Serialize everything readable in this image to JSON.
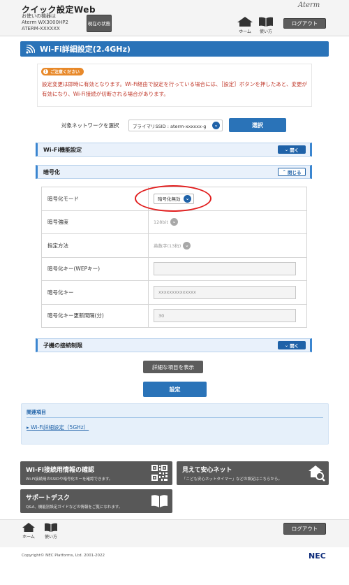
{
  "header": {
    "app_title": "クイック設定Web",
    "device_lines": [
      "お使いの機器は",
      "Aterm WX3000HP2",
      "ATERM-XXXXXX"
    ],
    "status_button": "現在の状態",
    "brand": "Aterm",
    "home_label": "ホーム",
    "manual_label": "使い方",
    "logout_label": "ログアウト"
  },
  "page": {
    "title": "Wi-Fi詳細設定(2.4GHz)",
    "notice_badge": "ご注意ください",
    "notice_text": "設定変更は即時に有効となります。Wi-Fi経由で設定を行っている場合には、［設定］ボタンを押したあと、変更が有効になり、Wi-Fi接続が切断される場合があります。",
    "network_label": "対象ネットワークを選択",
    "network_value": "プライマリSSID : aterm-xxxxxx-g",
    "select_button": "選択"
  },
  "sections": {
    "wifi_function": {
      "label": "Wi-Fi機能設定",
      "toggle": "開く"
    },
    "encryption": {
      "label": "暗号化",
      "toggle": "閉じる"
    },
    "child_limit": {
      "label": "子機の接続制限",
      "toggle": "開く"
    }
  },
  "encryption_rows": [
    {
      "label": "暗号化モード",
      "value": "暗号化無効"
    },
    {
      "label": "暗号強度",
      "value": "128bit"
    },
    {
      "label": "指定方法",
      "value": "英数字(13桁)"
    },
    {
      "label": "暗号化キー(WEPキー)",
      "value": ""
    },
    {
      "label": "暗号化キー",
      "value": "xxxxxxxxxxxxxx"
    },
    {
      "label": "暗号化キー更新間隔(分)",
      "value": "30"
    }
  ],
  "buttons": {
    "show_detail": "詳細な項目を表示",
    "apply": "設定"
  },
  "related": {
    "title": "関連項目",
    "link": "Wi-Fi詳細設定（5GHz）"
  },
  "cards": [
    {
      "title": "Wi-Fi接続用情報の確認",
      "desc": "Wi-Fi接続用のSSIDや暗号化キーを確認できます。",
      "icon": "qr-code-icon"
    },
    {
      "title": "見えて安心ネット",
      "desc": "「こども安心ネットタイマー」などの設定はこちらから。",
      "icon": "house-search-icon"
    },
    {
      "title": "サポートデスク",
      "desc": "Q&A、機能別設定ガイドなどの情報をご覧になれます。",
      "icon": "book-icon"
    }
  ],
  "footer": {
    "home_label": "ホーム",
    "manual_label": "使い方",
    "logout_label": "ログアウト",
    "copyright": "Copyright© NEC Platforms, Ltd. 2001-2022",
    "brand": "NEC"
  },
  "colors": {
    "accent": "#2a73b8",
    "caution": "#e8892a",
    "notice_text": "#c0392b",
    "highlight_ring": "#e11d1d"
  }
}
